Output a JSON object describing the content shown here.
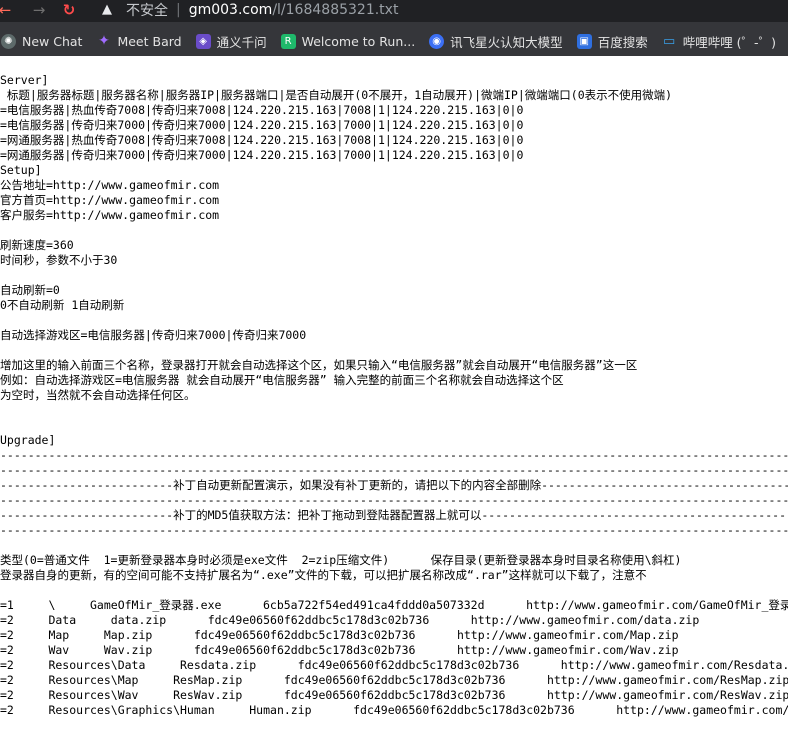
{
  "browser": {
    "insecure_label": "不安全",
    "separator": "|",
    "url_host": "gm003.com",
    "url_path": "/l/1684885321.txt",
    "bookmarks": [
      {
        "label": "New Chat",
        "icon": "chatgpt-icon"
      },
      {
        "label": "Meet Bard",
        "icon": "sparkle-icon"
      },
      {
        "label": "通义千问",
        "icon": "tongyi-icon"
      },
      {
        "label": "Welcome to Run...",
        "icon": "runway-icon"
      },
      {
        "label": "讯飞星火认知大模型",
        "icon": "spark-icon"
      },
      {
        "label": "百度搜索",
        "icon": "baidu-icon"
      },
      {
        "label": "哔哩哔哩 (゜-゜)",
        "icon": "bilibili-icon"
      }
    ]
  },
  "document": {
    "lines": [
      "Server]",
      " 标题|服务器标题|服务器名称|服务器IP|服务器端口|是否自动展开(0不展开，1自动展开)|微端IP|微端端口(0表示不使用微端)",
      "=电信服务器|热血传奇7008|传奇归来7008|124.220.215.163|7008|1|124.220.215.163|0|0",
      "=电信服务器|传奇归来7000|传奇归来7000|124.220.215.163|7000|1|124.220.215.163|0|0",
      "=网通服务器|热血传奇7008|传奇归来7008|124.220.215.163|7008|1|124.220.215.163|0|0",
      "=网通服务器|传奇归来7000|传奇归来7000|124.220.215.163|7000|1|124.220.215.163|0|0",
      "Setup]",
      "公告地址=http://www.gameofmir.com",
      "官方首页=http://www.gameofmir.com",
      "客户服务=http://www.gameofmir.com",
      "",
      "刷新速度=360",
      "时间秒，参数不小于30",
      "",
      "自动刷新=0",
      "0不自动刷新 1自动刷新",
      "",
      "自动选择游戏区=电信服务器|传奇归来7000|传奇归来7000",
      "",
      "增加这里的输入前面三个名称，登录器打开就会自动选择这个区，如果只输入“电信服务器”就会自动展开“电信服务器”这一区",
      "例如：自动选择游戏区=电信服务器 就会自动展开“电信服务器” 输入完整的前面三个名称就会自动选择这个区",
      "为空时，当然就不会自动选择任何区。",
      "",
      "",
      "Upgrade]",
      "------------------------------------------------------------------------------------------------------------------------",
      "------------------------------------------------------------------------------------------------------------------------",
      "-------------------------补丁自动更新配置演示，如果没有补丁更新的，请把以下的内容全部删除--------------------------------------------",
      "------------------------------------------------------------------------------------------------------------------------",
      "-------------------------补丁的MD5值获取方法：把补丁拖动到登陆器配置器上就可以----------------------------------------------------",
      "------------------------------------------------------------------------------------------------------------------------",
      "",
      "类型(0=普通文件  1=更新登录器本身时必须是exe文件  2=zip压缩文件)      保存目录(更新登录器本身时目录名称使用\\斜杠)",
      "登录器自身的更新，有的空间可能不支持扩展名为“.exe”文件的下载，可以把扩展名称改成“.rar”这样就可以下载了，注意不",
      "",
      "=1     \\     GameOfMir_登录器.exe      6cb5a722f54ed491ca4fddd0a507332d      http://www.gameofmir.com/GameOfMir_登录器",
      "=2     Data     data.zip      fdc49e06560f62ddbc5c178d3c02b736      http://www.gameofmir.com/data.zip",
      "=2     Map     Map.zip      fdc49e06560f62ddbc5c178d3c02b736      http://www.gameofmir.com/Map.zip",
      "=2     Wav     Wav.zip      fdc49e06560f62ddbc5c178d3c02b736      http://www.gameofmir.com/Wav.zip",
      "=2     Resources\\Data     Resdata.zip      fdc49e06560f62ddbc5c178d3c02b736      http://www.gameofmir.com/Resdata.zip",
      "=2     Resources\\Map     ResMap.zip      fdc49e06560f62ddbc5c178d3c02b736      http://www.gameofmir.com/ResMap.zip",
      "=2     Resources\\Wav     ResWav.zip      fdc49e06560f62ddbc5c178d3c02b736      http://www.gameofmir.com/ResWav.zip",
      "=2     Resources\\Graphics\\Human     Human.zip      fdc49e06560f62ddbc5c178d3c02b736      http://www.gameofmir.com/Human.zip"
    ]
  }
}
